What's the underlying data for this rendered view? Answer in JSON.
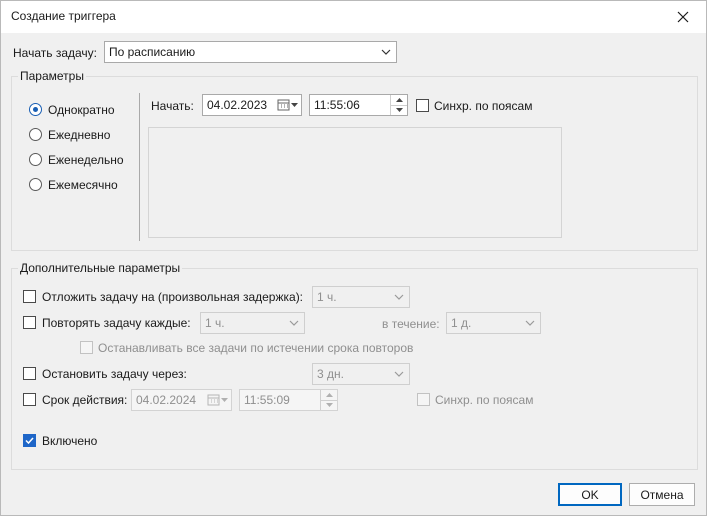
{
  "window": {
    "title": "Создание триггера",
    "close_icon": "close-icon"
  },
  "start_task": {
    "label": "Начать задачу:",
    "value": "По расписанию"
  },
  "params": {
    "title": "Параметры",
    "radios": [
      {
        "label": "Однократно",
        "checked": true
      },
      {
        "label": "Ежедневно",
        "checked": false
      },
      {
        "label": "Еженедельно",
        "checked": false
      },
      {
        "label": "Ежемесячно",
        "checked": false
      }
    ],
    "start_label": "Начать:",
    "start_date": "04.02.2023",
    "start_time": "11:55:06",
    "sync_label": "Синхр. по поясам"
  },
  "advanced": {
    "title": "Дополнительные параметры",
    "delay_label": "Отложить задачу на (произвольная задержка):",
    "delay_value": "1 ч.",
    "repeat_label": "Повторять задачу каждые:",
    "repeat_value": "1 ч.",
    "during_label": "в течение:",
    "during_value": "1 д.",
    "stop_all_label": "Останавливать все задачи по истечении срока повторов",
    "stop_after_label": "Остановить задачу через:",
    "stop_after_value": "3 дн.",
    "expire_label": "Срок действия:",
    "expire_date": "04.02.2024",
    "expire_time": "11:55:09",
    "expire_sync_label": "Синхр. по поясам",
    "enabled_label": "Включено"
  },
  "buttons": {
    "ok": "OK",
    "cancel": "Отмена"
  },
  "colors": {
    "accent": "#0067c0",
    "checked": "#1e66c8"
  }
}
